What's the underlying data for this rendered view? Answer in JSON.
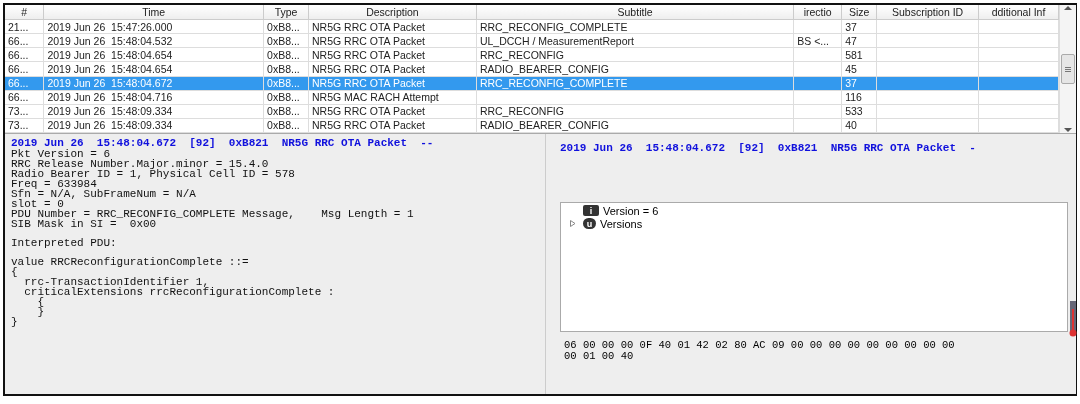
{
  "table": {
    "columns": [
      "#",
      "Time",
      "Type",
      "Description",
      "Subtitle",
      "irectio",
      "Size",
      "Subscription ID",
      "dditional Inf"
    ],
    "rows": [
      {
        "cells": [
          "21...",
          "2019 Jun 26  15:47:26.000",
          "0xB8...",
          "NR5G RRC OTA Packet",
          "RRC_RECONFIG_COMPLETE",
          "",
          "37",
          "",
          ""
        ],
        "selected": false
      },
      {
        "cells": [
          "66...",
          "2019 Jun 26  15:48:04.532",
          "0xB8...",
          "NR5G RRC OTA Packet",
          "UL_DCCH / MeasurementReport",
          "BS <...",
          "47",
          "",
          ""
        ],
        "selected": false
      },
      {
        "cells": [
          "66...",
          "2019 Jun 26  15:48:04.654",
          "0xB8...",
          "NR5G RRC OTA Packet",
          "RRC_RECONFIG",
          "",
          "581",
          "",
          ""
        ],
        "selected": false
      },
      {
        "cells": [
          "66...",
          "2019 Jun 26  15:48:04.654",
          "0xB8...",
          "NR5G RRC OTA Packet",
          "RADIO_BEARER_CONFIG",
          "",
          "45",
          "",
          ""
        ],
        "selected": false
      },
      {
        "cells": [
          "66...",
          "2019 Jun 26  15:48:04.672",
          "0xB8...",
          "NR5G RRC OTA Packet",
          "RRC_RECONFIG_COMPLETE",
          "",
          "37",
          "",
          ""
        ],
        "selected": true
      },
      {
        "cells": [
          "66...",
          "2019 Jun 26  15:48:04.716",
          "0xB8...",
          "NR5G MAC RACH Attempt",
          "",
          "",
          "116",
          "",
          ""
        ],
        "selected": false
      },
      {
        "cells": [
          "73...",
          "2019 Jun 26  15:48:09.334",
          "0xB8...",
          "NR5G RRC OTA Packet",
          "RRC_RECONFIG",
          "",
          "533",
          "",
          ""
        ],
        "selected": false
      },
      {
        "cells": [
          "73...",
          "2019 Jun 26  15:48:09.334",
          "0xB8...",
          "NR5G RRC OTA Packet",
          "RADIO_BEARER_CONFIG",
          "",
          "40",
          "",
          ""
        ],
        "selected": false
      }
    ]
  },
  "details": {
    "header": "2019 Jun 26  15:48:04.672  [92]  0xB821  NR5G RRC OTA Packet  --",
    "blocks": [
      [
        "Pkt Version = 6",
        "RRC Release Number.Major.minor = 15.4.0",
        "Radio Bearer ID = 1, Physical Cell ID = 578",
        "Freq = 633984",
        "Sfn = N/A, SubFrameNum = N/A",
        "slot = 0",
        "PDU Number = RRC_RECONFIG_COMPLETE Message,    Msg Length = 1",
        "SIB Mask in SI =  0x00"
      ],
      [
        "Interpreted PDU:"
      ],
      [
        "value RRCReconfigurationComplete ::=",
        "{",
        "  rrc-TransactionIdentifier 1,",
        "  criticalExtensions rrcReconfigurationComplete :",
        "    {",
        "    }",
        "}"
      ]
    ]
  },
  "inspector": {
    "header": "2019 Jun 26  15:48:04.672  [92]  0xB821  NR5G RRC OTA Packet  -",
    "tree": [
      {
        "kind": "info",
        "icon_letter": "i",
        "label": "Version = 6"
      },
      {
        "kind": "group",
        "icon_letter": "u",
        "label": "Versions",
        "expanded": false
      }
    ],
    "hex": [
      "06 00 00 00 0F 40 01 42 02 80 AC 09 00 00 00 00 00 00 00 00 00",
      "00 01 00 40"
    ]
  }
}
